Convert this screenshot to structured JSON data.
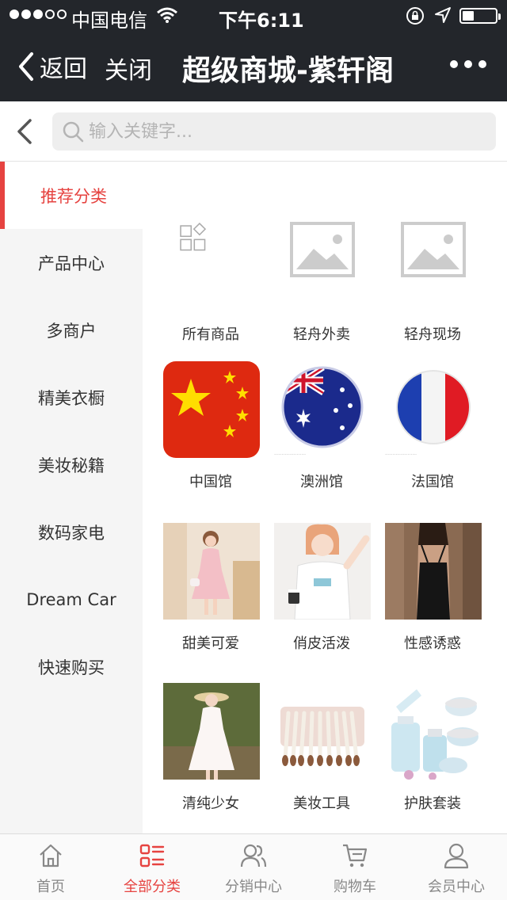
{
  "status_bar": {
    "carrier": "中国电信",
    "time": "下午6:11"
  },
  "nav": {
    "back_label": "返回",
    "close_label": "关闭",
    "title": "超级商城-紫轩阁"
  },
  "search": {
    "placeholder": "输入关键字..."
  },
  "sidebar": {
    "items": [
      {
        "label": "推荐分类",
        "active": true
      },
      {
        "label": "产品中心"
      },
      {
        "label": "多商户"
      },
      {
        "label": "精美衣橱"
      },
      {
        "label": "美妆秘籍"
      },
      {
        "label": "数码家电"
      },
      {
        "label": "Dream Car"
      },
      {
        "label": "快速购买"
      }
    ]
  },
  "grid": {
    "items": [
      {
        "label": "所有商品",
        "icon": "grid-icon"
      },
      {
        "label": "轻舟外卖",
        "icon": "image-placeholder-icon"
      },
      {
        "label": "轻舟现场",
        "icon": "image-placeholder-icon"
      },
      {
        "label": "中国馆",
        "icon": "china-flag"
      },
      {
        "label": "澳洲馆",
        "icon": "australia-flag"
      },
      {
        "label": "法国馆",
        "icon": "france-flag"
      },
      {
        "label": "甜美可爱",
        "icon": "photo-pink-dress"
      },
      {
        "label": "俏皮活泼",
        "icon": "photo-white-tshirt"
      },
      {
        "label": "性感诱惑",
        "icon": "photo-black-dress"
      },
      {
        "label": "清纯少女",
        "icon": "photo-white-dress"
      },
      {
        "label": "美妆工具",
        "icon": "photo-brushes"
      },
      {
        "label": "护肤套装",
        "icon": "photo-skincare"
      }
    ]
  },
  "tabbar": {
    "items": [
      {
        "label": "首页",
        "icon": "home-icon"
      },
      {
        "label": "全部分类",
        "icon": "category-icon",
        "active": true
      },
      {
        "label": "分销中心",
        "icon": "users-icon"
      },
      {
        "label": "购物车",
        "icon": "cart-icon"
      },
      {
        "label": "会员中心",
        "icon": "user-icon"
      }
    ]
  },
  "colors": {
    "accent": "#e64340",
    "header_bg": "#23262b",
    "sidebar_bg": "#f5f5f5"
  }
}
